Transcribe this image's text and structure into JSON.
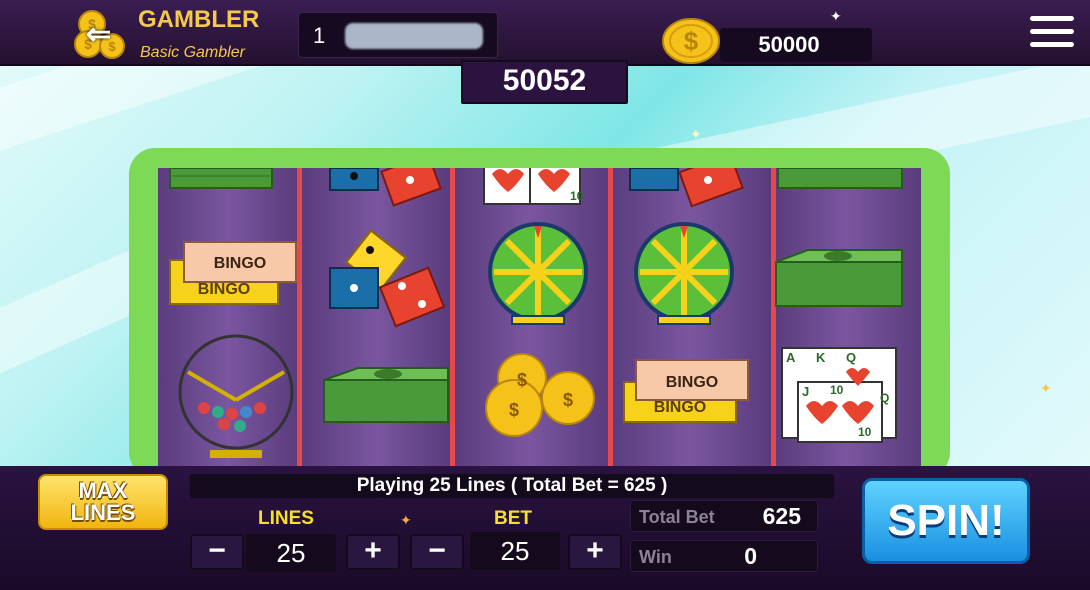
{
  "header": {
    "player_name": "GAMBLER",
    "player_rank": "Basic Gambler",
    "level": "1",
    "balance": "50000"
  },
  "jackpot": "50052",
  "reels": [
    {
      "symbols": [
        "cash-stack",
        "bingo-tickets",
        "bingo-cage"
      ],
      "ticket_text": "BINGO"
    },
    {
      "symbols": [
        "dice",
        "dice",
        "cash-stack"
      ]
    },
    {
      "symbols": [
        "playing-cards",
        "prize-wheel",
        "gold-coins"
      ],
      "card_value": "10"
    },
    {
      "symbols": [
        "dice",
        "prize-wheel",
        "bingo-tickets"
      ],
      "ticket_text": "BINGO"
    },
    {
      "symbols": [
        "cash-stack",
        "cash-stack",
        "playing-cards"
      ],
      "cards": [
        "A",
        "K",
        "Q",
        "J",
        "10",
        "Q",
        "10"
      ]
    }
  ],
  "controls": {
    "max_lines_line1": "MAX",
    "max_lines_line2": "LINES",
    "status_message": "Playing 25 Lines ( Total Bet = 625 )",
    "lines_label": "LINES",
    "lines_value": "25",
    "bet_label": "BET",
    "bet_value": "25",
    "minus": "−",
    "plus": "+",
    "total_bet_label": "Total Bet",
    "total_bet_value": "625",
    "win_label": "Win",
    "win_value": "0",
    "spin_label": "SPIN!"
  },
  "colors": {
    "frame": "#7ed957",
    "accent_gold": "#f5c94a",
    "spin_blue": "#1a8fe0"
  },
  "icons": {
    "coin": "dollar-coin-icon",
    "back": "back-arrow-icon",
    "menu": "hamburger-menu-icon"
  }
}
